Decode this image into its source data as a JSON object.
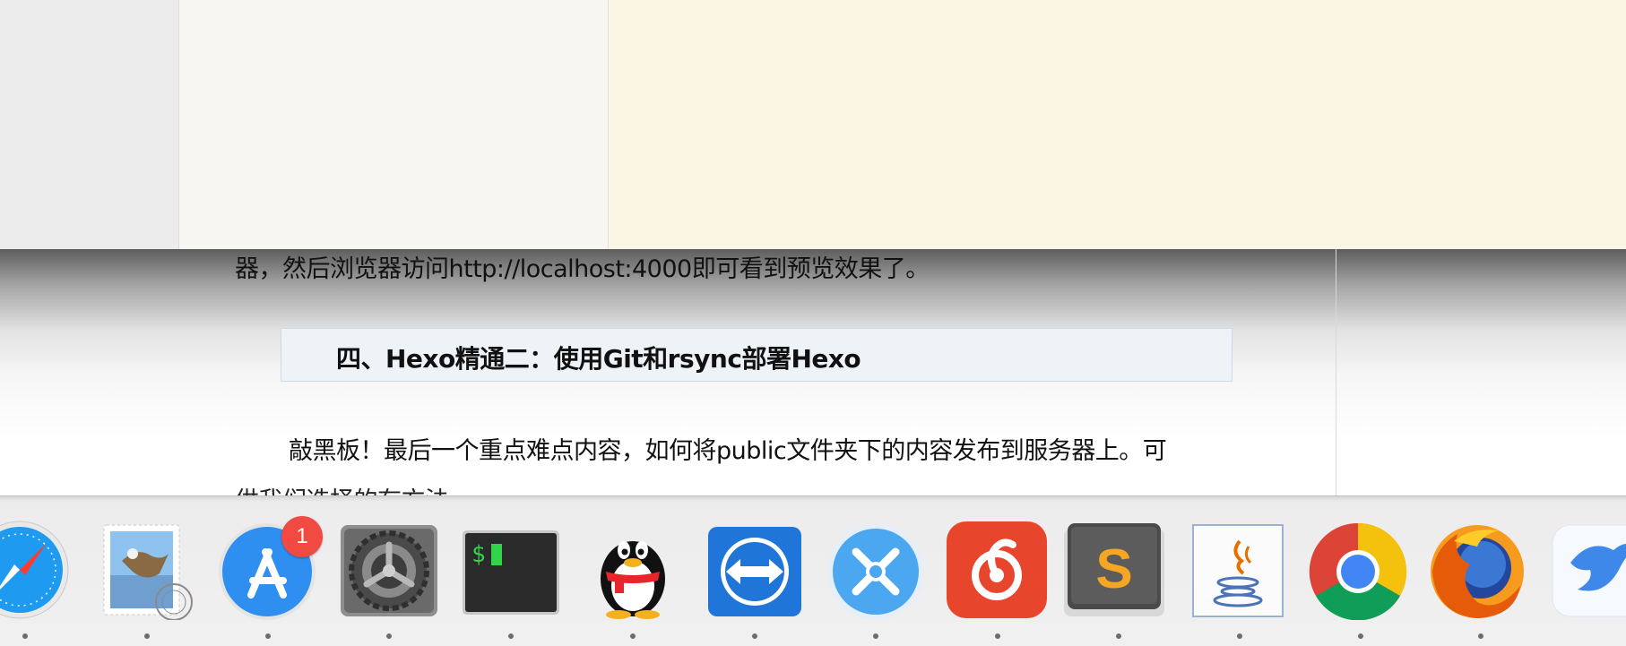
{
  "article": {
    "line1": "器，然后浏览器访问http://localhost:4000即可看到预览效果了。",
    "heading": "四、Hexo精通二：使用Git和rsync部署Hexo",
    "line2": "敲黑板！最后一个重点难点内容，如何将public文件夹下的内容发布到服务器上。可",
    "line3": "供我们选择的有方法"
  },
  "dock": {
    "items": [
      {
        "name": "safari-icon"
      },
      {
        "name": "mail-icon"
      },
      {
        "name": "app-store-icon",
        "badge": "1"
      },
      {
        "name": "system-preferences-icon"
      },
      {
        "name": "terminal-icon",
        "prompt": "$"
      },
      {
        "name": "qq-icon"
      },
      {
        "name": "teamviewer-icon"
      },
      {
        "name": "xmind-icon"
      },
      {
        "name": "netease-music-icon"
      },
      {
        "name": "sublime-text-icon",
        "letter": "S"
      },
      {
        "name": "java-icon"
      },
      {
        "name": "chrome-icon"
      },
      {
        "name": "firefox-icon"
      },
      {
        "name": "bird-app-icon"
      }
    ]
  },
  "colors": {
    "note_pane": "#fbf5e3",
    "heading_bg": "#eef3f8",
    "badge": "#f04a43"
  }
}
